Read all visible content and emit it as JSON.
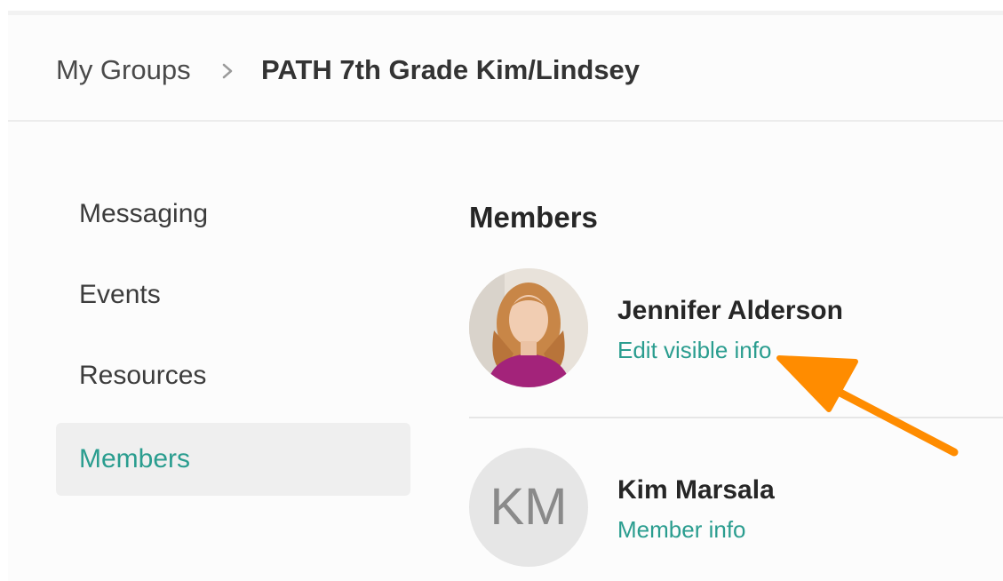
{
  "breadcrumb": {
    "root": "My Groups",
    "separator_icon": "chevron-right-icon",
    "current": "PATH 7th Grade Kim/Lindsey"
  },
  "sidebar": {
    "items": [
      {
        "label": "Messaging",
        "active": false
      },
      {
        "label": "Events",
        "active": false
      },
      {
        "label": "Resources",
        "active": false
      },
      {
        "label": "Members",
        "active": true
      }
    ]
  },
  "main": {
    "heading": "Members",
    "members": [
      {
        "name": "Jennifer Alderson",
        "link": "Edit visible info",
        "avatar": "photo"
      },
      {
        "name": "Kim Marsala",
        "link": "Member info",
        "avatar_initials": "KM"
      }
    ]
  },
  "annotation": {
    "type": "arrow",
    "color": "#ff8c00"
  },
  "colors": {
    "accent": "#2a9d8f",
    "active_nav_bg": "#efefef"
  }
}
